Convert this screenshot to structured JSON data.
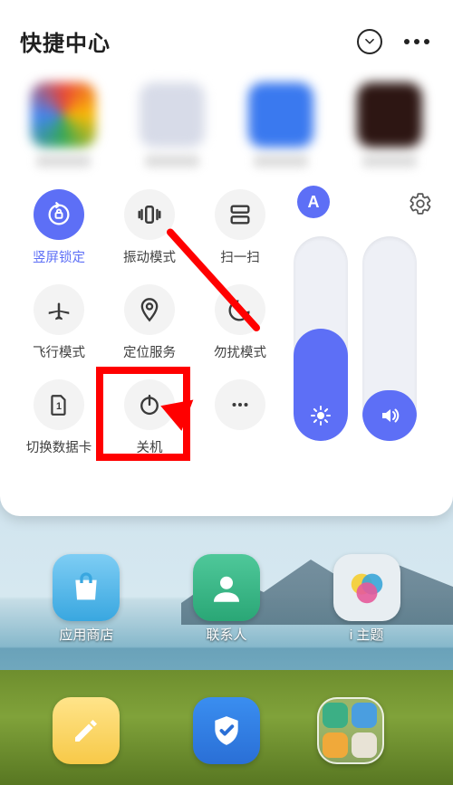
{
  "header": {
    "title": "快捷中心"
  },
  "auto_label": "A",
  "quick_settings": {
    "portrait_lock": "竖屏锁定",
    "vibrate": "振动模式",
    "scan": "扫一扫",
    "airplane": "飞行模式",
    "location": "定位服务",
    "dnd": "勿扰模式",
    "sim": "切换数据卡",
    "power": "关机"
  },
  "home_apps": {
    "store": "应用商店",
    "contacts": "联系人",
    "themes": "i 主题"
  }
}
